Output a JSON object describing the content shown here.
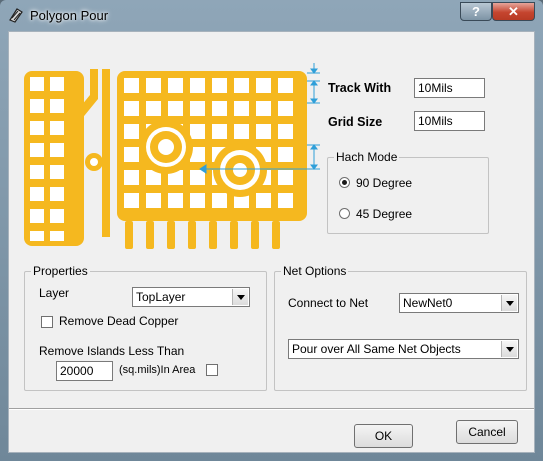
{
  "window": {
    "title": "Polygon Pour",
    "help_label": "?",
    "close_label": "✕",
    "icon": "polygon-pour-app-icon"
  },
  "preview": {
    "icon": "hatched-polygon-preview",
    "copper_color": "#f5b81f",
    "arrow_color": "#2f9fd9"
  },
  "track": {
    "label": "Track With",
    "value": "10Mils"
  },
  "grid": {
    "label": "Grid Size",
    "value": "10Mils"
  },
  "hatch_mode": {
    "title": "Hach Mode",
    "options": [
      {
        "label": "90 Degree",
        "selected": true
      },
      {
        "label": "45 Degree",
        "selected": false
      }
    ]
  },
  "properties": {
    "title": "Properties",
    "layer_label": "Layer",
    "layer_value": "TopLayer",
    "remove_dead_copper_label": "Remove Dead Copper",
    "remove_dead_copper_checked": false,
    "remove_islands_label": "Remove Islands Less Than",
    "island_value": "20000",
    "island_unit": "(sq.mils)In Area",
    "in_area_checked": false
  },
  "net_options": {
    "title": "Net Options",
    "connect_label": "Connect to Net",
    "net_value": "NewNet0",
    "pour_value": "Pour over All Same Net Objects"
  },
  "buttons": {
    "ok": "OK",
    "cancel": "Cancel"
  }
}
